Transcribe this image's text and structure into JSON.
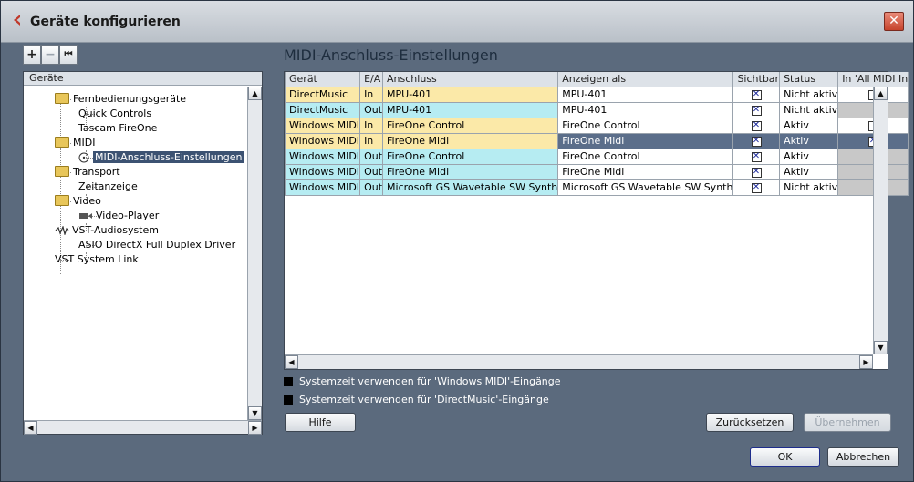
{
  "window": {
    "title": "Geräte konfigurieren",
    "close_glyph": "✕"
  },
  "toolbar": {
    "add_glyph": "+",
    "remove_glyph": "−",
    "reset_glyph": "⏮"
  },
  "section_title": "MIDI-Anschluss-Einstellungen",
  "tree": {
    "header": "Geräte",
    "items": [
      {
        "label": "Fernbedienungsgeräte",
        "icon": "folder-icon"
      },
      {
        "label": "Quick Controls"
      },
      {
        "label": "Tascam FireOne"
      },
      {
        "label": "MIDI",
        "icon": "folder-icon"
      },
      {
        "label": "MIDI-Anschluss-Einstellungen",
        "icon": "midi-port-icon",
        "selected": true
      },
      {
        "label": "Transport",
        "icon": "folder-icon"
      },
      {
        "label": "Zeitanzeige"
      },
      {
        "label": "Video",
        "icon": "folder-icon"
      },
      {
        "label": "Video-Player",
        "icon": "video-icon"
      },
      {
        "label": "VST-Audiosystem",
        "icon": "audio-icon"
      },
      {
        "label": "ASIO DirectX Full Duplex Driver"
      },
      {
        "label": "VST System Link"
      }
    ]
  },
  "table": {
    "columns": [
      "Gerät",
      "E/A",
      "Anschluss",
      "Anzeigen als",
      "Sichtbar",
      "Status",
      "In 'All MIDI In"
    ],
    "rows": [
      {
        "device": "DirectMusic",
        "io": "In",
        "port": "MPU-401",
        "show_as": "MPU-401",
        "visible": true,
        "status": "Nicht aktiv",
        "all_midi": "unchecked",
        "type": "in"
      },
      {
        "device": "DirectMusic",
        "io": "Out",
        "port": "MPU-401",
        "show_as": "MPU-401",
        "visible": true,
        "status": "Nicht aktiv",
        "all_midi": "na",
        "type": "out"
      },
      {
        "device": "Windows MIDI",
        "io": "In",
        "port": "FireOne Control",
        "show_as": "FireOne Control",
        "visible": true,
        "status": "Aktiv",
        "all_midi": "unchecked",
        "type": "in"
      },
      {
        "device": "Windows MIDI",
        "io": "In",
        "port": "FireOne Midi",
        "show_as": "FireOne Midi",
        "visible": true,
        "status": "Aktiv",
        "all_midi": "checked",
        "type": "in",
        "selected": true
      },
      {
        "device": "Windows MIDI",
        "io": "Out",
        "port": "FireOne Control",
        "show_as": "FireOne Control",
        "visible": true,
        "status": "Aktiv",
        "all_midi": "na",
        "type": "out"
      },
      {
        "device": "Windows MIDI",
        "io": "Out",
        "port": "FireOne Midi",
        "show_as": "FireOne Midi",
        "visible": true,
        "status": "Aktiv",
        "all_midi": "na",
        "type": "out"
      },
      {
        "device": "Windows MIDI",
        "io": "Out",
        "port": "Microsoft GS Wavetable SW Synth",
        "show_as": "Microsoft GS Wavetable SW Synth",
        "visible": true,
        "status": "Nicht aktiv",
        "all_midi": "na",
        "type": "out"
      }
    ]
  },
  "options": {
    "system_time_windows_midi": "Systemzeit verwenden für 'Windows MIDI'-Eingänge",
    "system_time_directmusic": "Systemzeit verwenden für 'DirectMusic'-Eingänge"
  },
  "buttons": {
    "help": "Hilfe",
    "reset": "Zurücksetzen",
    "apply": "Übernehmen",
    "ok": "OK",
    "cancel": "Abbrechen"
  }
}
